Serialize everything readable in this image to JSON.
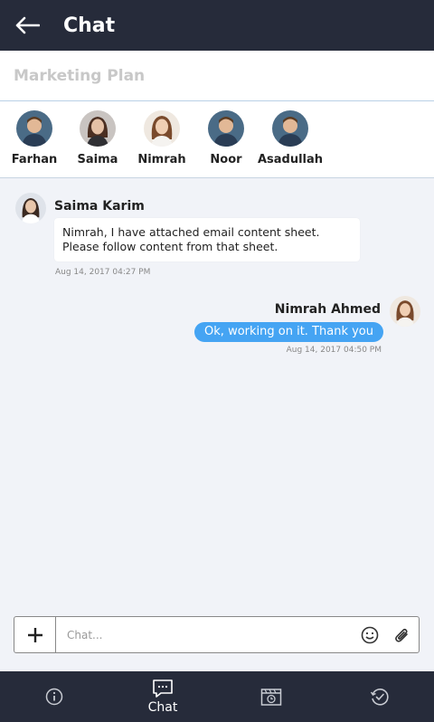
{
  "header": {
    "title": "Chat",
    "back_icon": "arrow-left-icon"
  },
  "subject": {
    "placeholder": "Marketing Plan"
  },
  "members": [
    {
      "name": "Farhan",
      "avatar_kind": "male"
    },
    {
      "name": "Saima",
      "avatar_kind": "female"
    },
    {
      "name": "Nimrah",
      "avatar_kind": "female-light"
    },
    {
      "name": "Noor",
      "avatar_kind": "male"
    },
    {
      "name": "Asadullah",
      "avatar_kind": "male"
    }
  ],
  "messages": [
    {
      "sender": "Saima Karim",
      "text": "Nimrah, I have attached email content sheet. Please follow content from that sheet.",
      "timestamp": "Aug 14, 2017   04:27 PM",
      "direction": "incoming"
    },
    {
      "sender": "Nimrah Ahmed",
      "text": "Ok, working on it. Thank you",
      "timestamp": "Aug 14, 2017   04:50 PM",
      "direction": "outgoing"
    }
  ],
  "composer": {
    "placeholder": "Chat..."
  },
  "nav": [
    {
      "label": "",
      "icon": "info-icon"
    },
    {
      "label": "Chat",
      "icon": "chat-bubble-icon",
      "active": true
    },
    {
      "label": "",
      "icon": "calendar-clock-icon"
    },
    {
      "label": "",
      "icon": "history-icon"
    }
  ],
  "colors": {
    "bar": "#262b3a",
    "accent": "#45a4f3",
    "background": "#f1f3f8"
  }
}
